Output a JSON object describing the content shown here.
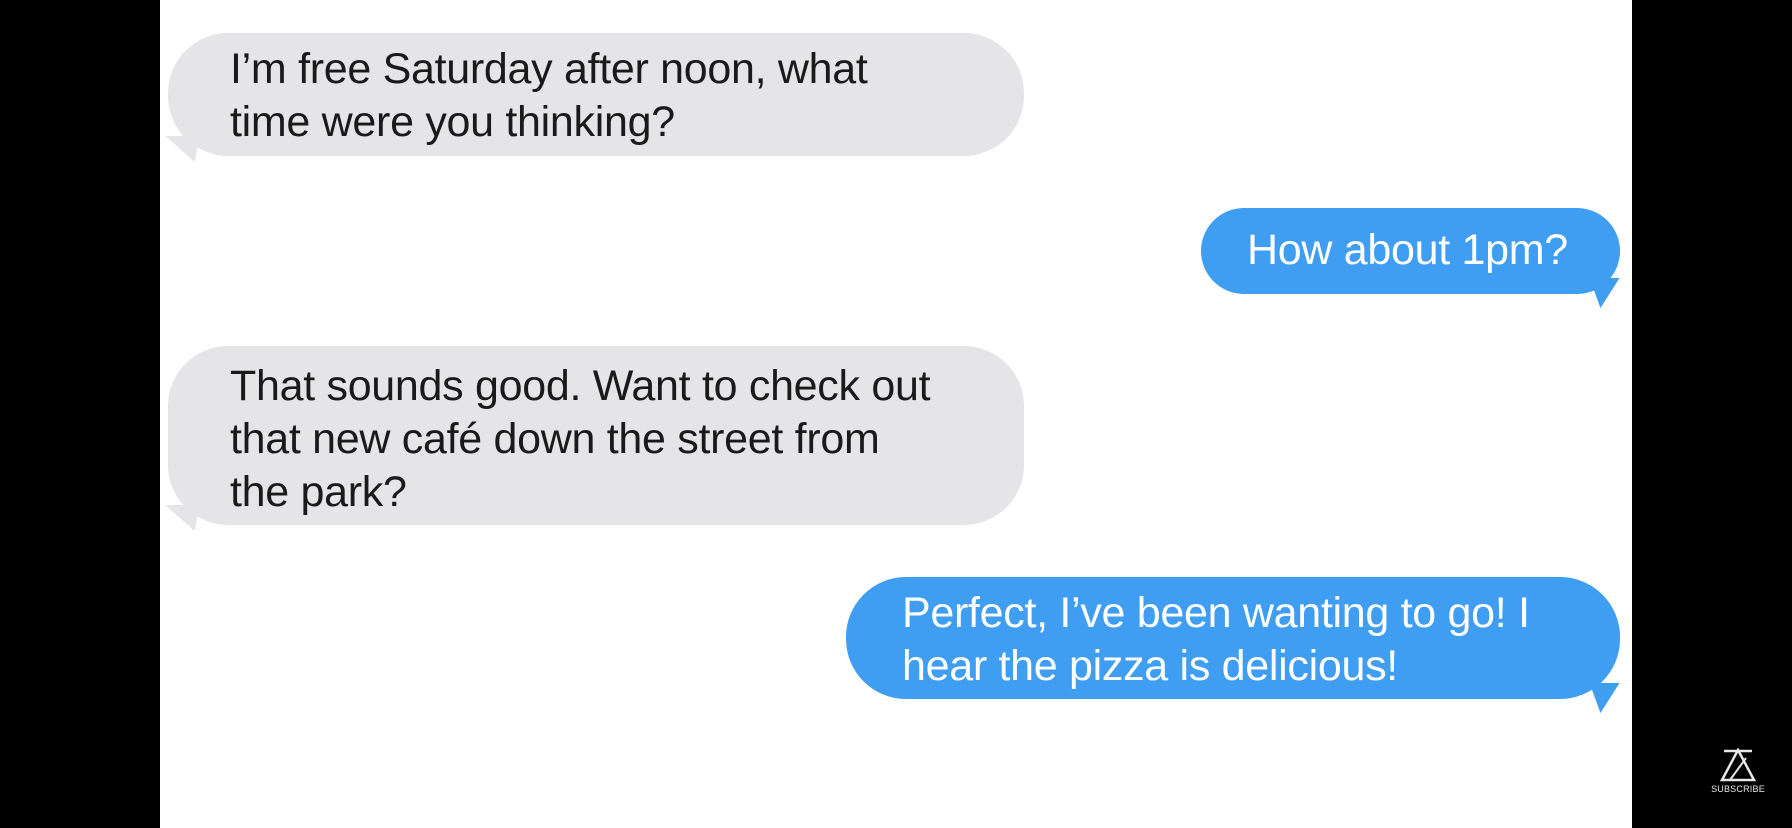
{
  "conversation": {
    "messages": [
      {
        "sender": "received",
        "text": "I’m free Saturday after noon, what\ntime were you thinking?"
      },
      {
        "sender": "sent",
        "text": "How about 1pm?"
      },
      {
        "sender": "received",
        "text": "That sounds good. Want to check out\nthat new café down the street from\nthe park?"
      },
      {
        "sender": "sent",
        "text": "Perfect, I’ve been wanting to go! I\nhear the pizza is delicious!"
      }
    ]
  },
  "colors": {
    "received_bubble": "#e5e5e7",
    "sent_bubble": "#3f9df2",
    "background": "#ffffff",
    "letterbox": "#000000"
  },
  "watermark": {
    "icon": "channel-logo-icon",
    "label": "SUBSCRIBE"
  }
}
